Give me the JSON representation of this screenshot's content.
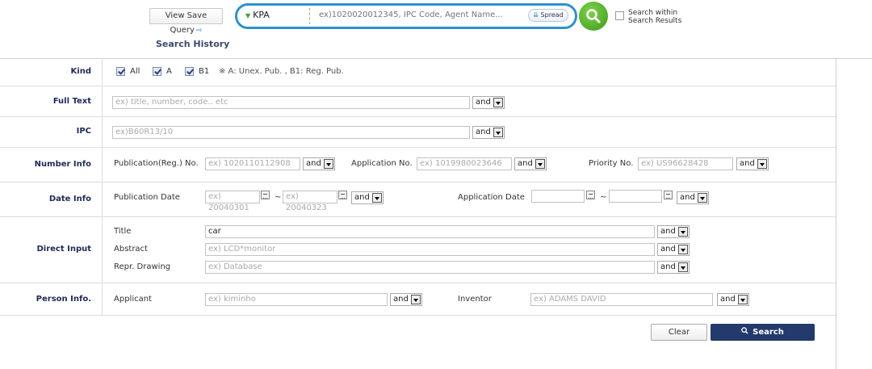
{
  "top": {
    "view_save_query": "View Save Query",
    "db_selected": "KPA",
    "search_placeholder": "ex)1020020012345, IPC Code, Agent Name...",
    "spread": "Spread",
    "search_within": "Search within\nSearch Results",
    "search_history": "Search History"
  },
  "kind": {
    "label": "Kind",
    "options": [
      "All",
      "A",
      "B1"
    ],
    "note": "※ A: Unex. Pub. , B1: Reg. Pub."
  },
  "full_text": {
    "label": "Full Text",
    "placeholder": "ex) title, number, code.. etc",
    "op": "and"
  },
  "ipc": {
    "label": "IPC",
    "placeholder": "ex)B60R13/10",
    "op": "and"
  },
  "number_info": {
    "label": "Number Info",
    "pub_label": "Publication(Reg.) No.",
    "pub_placeholder": "ex) 1020110112908",
    "pub_op": "and",
    "app_label": "Application No.",
    "app_placeholder": "ex) 1019980023646",
    "app_op": "and",
    "pri_label": "Priority No.",
    "pri_placeholder": "ex) US96628428",
    "pri_op": "and"
  },
  "date_info": {
    "label": "Date Info",
    "pub_label": "Publication Date",
    "pub_from": "ex) 20040301",
    "tilde": "~",
    "pub_to": "ex) 20040323",
    "pub_op": "and",
    "app_label": "Application Date",
    "app_op": "and"
  },
  "direct_input": {
    "label": "Direct Input",
    "title_label": "Title",
    "title_value": "car",
    "title_op": "and",
    "abstract_label": "Abstract",
    "abstract_placeholder": "ex) LCD*monitor",
    "abstract_op": "and",
    "drawing_label": "Repr. Drawing",
    "drawing_placeholder": "ex) Database",
    "drawing_op": "and"
  },
  "person_info": {
    "label": "Person Info.",
    "applicant_label": "Applicant",
    "applicant_placeholder": "ex) kiminho",
    "applicant_op": "and",
    "inventor_label": "Inventor",
    "inventor_placeholder": "ex) ADAMS DAVID",
    "inventor_op": "and"
  },
  "actions": {
    "clear": "Clear",
    "search": "Search"
  }
}
